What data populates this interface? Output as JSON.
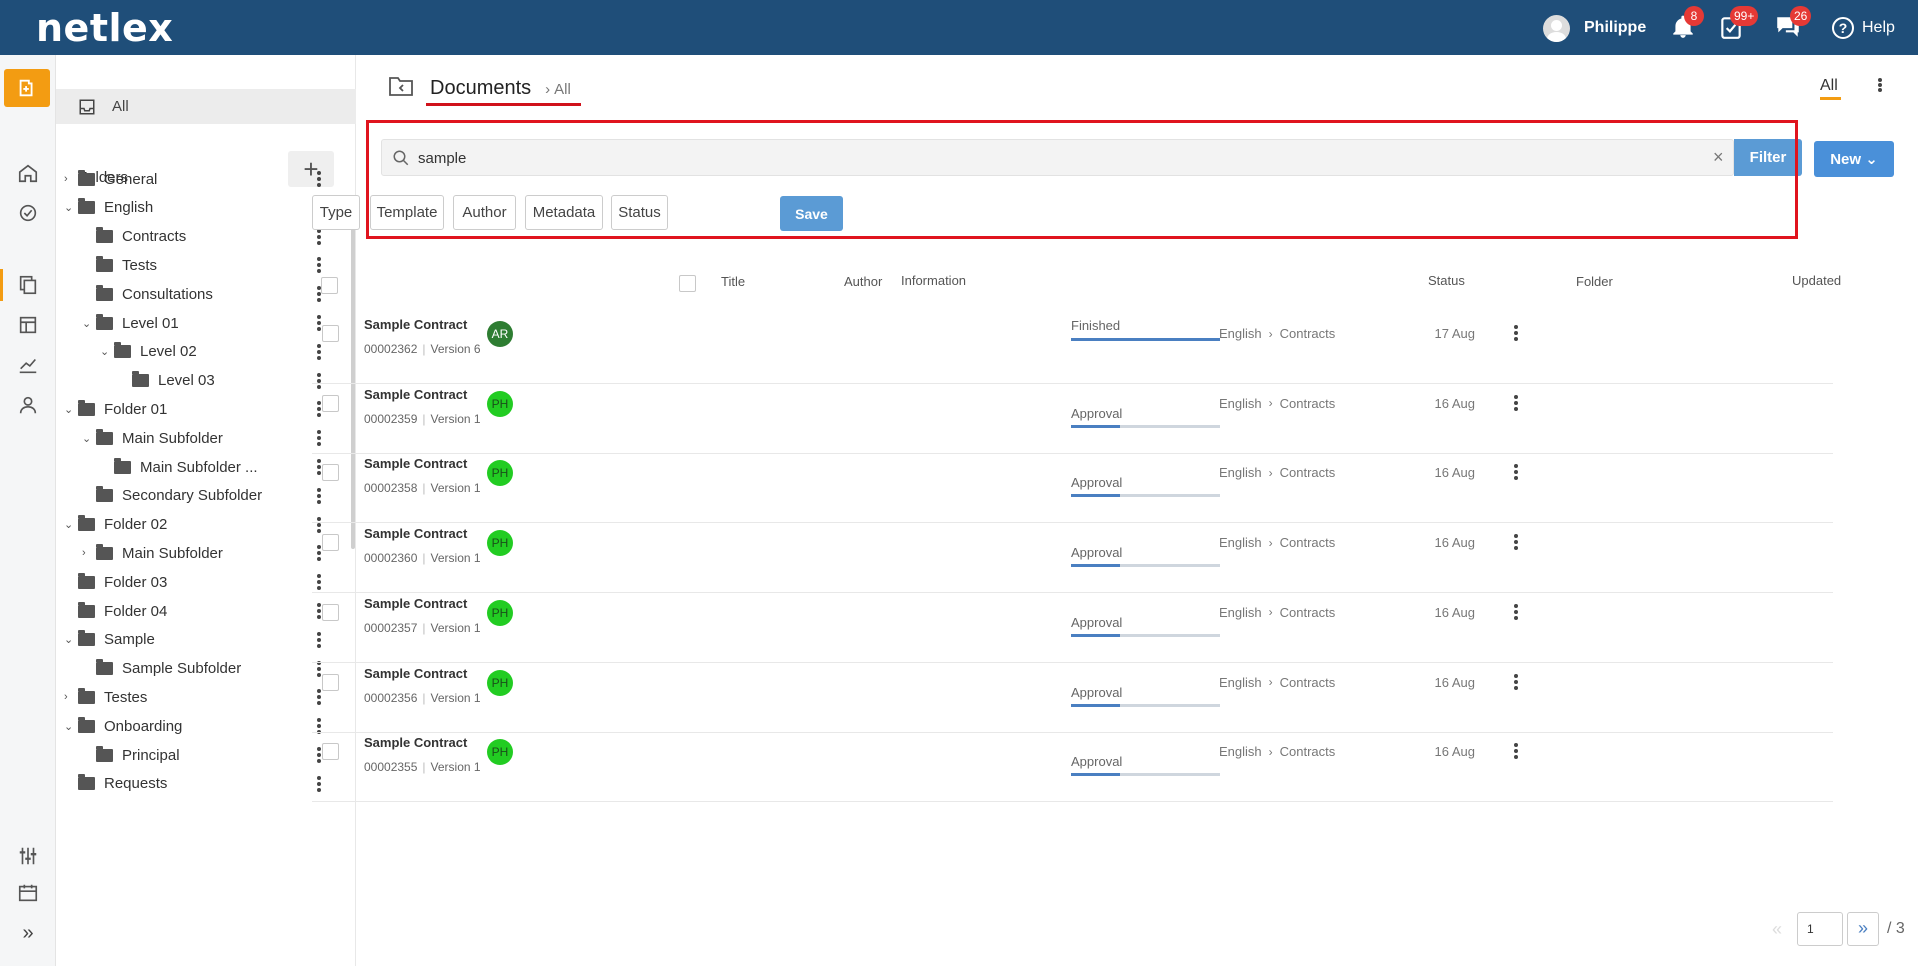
{
  "app": {
    "logo": "netlex"
  },
  "topbar": {
    "user_name": "Philippe",
    "notifications_badge": "8",
    "tasks_badge": "99+",
    "messages_badge": "26",
    "help_label": "Help"
  },
  "rail": {
    "icons": [
      "new-document-icon",
      "home-icon",
      "dashboard-icon",
      "documents-icon",
      "board-icon",
      "analytics-icon",
      "user-icon",
      "settings-sliders-icon",
      "calendar-icon",
      "expand-icon"
    ]
  },
  "sidebar": {
    "all_label": "All",
    "folders_label": "Folders",
    "add_label": "+",
    "tree": [
      {
        "label": "General",
        "indent": 0,
        "chevron": "›"
      },
      {
        "label": "English",
        "indent": 0,
        "chevron": "⌄"
      },
      {
        "label": "Contracts",
        "indent": 1,
        "chevron": ""
      },
      {
        "label": "Tests",
        "indent": 1,
        "chevron": ""
      },
      {
        "label": "Consultations",
        "indent": 1,
        "chevron": ""
      },
      {
        "label": "Level 01",
        "indent": 1,
        "chevron": "⌄"
      },
      {
        "label": "Level 02",
        "indent": 2,
        "chevron": "⌄"
      },
      {
        "label": "Level 03",
        "indent": 3,
        "chevron": ""
      },
      {
        "label": "Folder 01",
        "indent": 0,
        "chevron": "⌄"
      },
      {
        "label": "Main Subfolder",
        "indent": 1,
        "chevron": "⌄"
      },
      {
        "label": "Main Subfolder ...",
        "indent": 2,
        "chevron": ""
      },
      {
        "label": "Secondary Subfolder",
        "indent": 1,
        "chevron": ""
      },
      {
        "label": "Folder 02",
        "indent": 0,
        "chevron": "⌄"
      },
      {
        "label": "Main Subfolder",
        "indent": 1,
        "chevron": "›"
      },
      {
        "label": "Folder 03",
        "indent": 0,
        "chevron": ""
      },
      {
        "label": "Folder 04",
        "indent": 0,
        "chevron": ""
      },
      {
        "label": "Sample",
        "indent": 0,
        "chevron": "⌄"
      },
      {
        "label": "Sample Subfolder",
        "indent": 1,
        "chevron": ""
      },
      {
        "label": "Testes",
        "indent": 0,
        "chevron": "›"
      },
      {
        "label": "Onboarding",
        "indent": 0,
        "chevron": "⌄"
      },
      {
        "label": "Principal",
        "indent": 1,
        "chevron": ""
      },
      {
        "label": "Requests",
        "indent": 0,
        "chevron": ""
      }
    ]
  },
  "header": {
    "title": "Documents",
    "breadcrumb_sub": "All",
    "view_label": "All"
  },
  "search": {
    "value": "sample",
    "clear_label": "×",
    "filter_label": "Filter",
    "new_label": "New ⌄"
  },
  "chips": [
    {
      "label": "Type",
      "name": "type"
    },
    {
      "label": "Template",
      "name": "template"
    },
    {
      "label": "Author",
      "name": "author"
    },
    {
      "label": "Metadata",
      "name": "metadata"
    },
    {
      "label": "Status",
      "name": "status"
    }
  ],
  "chips_save_label": "Save",
  "table": {
    "columns": {
      "title": "Title",
      "author": "Author",
      "information": "Information",
      "status": "Status",
      "folder": "Folder",
      "updated": "Updated"
    },
    "rows": [
      {
        "title": "Sample Contract",
        "number": "00002362",
        "version": "Version 6",
        "author": "AR",
        "author_color": "#2e7d32",
        "author_text": "#ffffff",
        "status": "Finished",
        "progress": 1.0,
        "folder": [
          "English",
          "Contracts"
        ],
        "updated": "17 Aug"
      },
      {
        "title": "Sample Contract",
        "number": "00002359",
        "version": "Version 1",
        "author": "PH",
        "author_color": "#22cc22",
        "author_text": "#1a4d1a",
        "status": "Approval",
        "progress": 0.33,
        "folder": [
          "English",
          "Contracts"
        ],
        "updated": "16 Aug"
      },
      {
        "title": "Sample Contract",
        "number": "00002358",
        "version": "Version 1",
        "author": "PH",
        "author_color": "#22cc22",
        "author_text": "#1a4d1a",
        "status": "Approval",
        "progress": 0.33,
        "folder": [
          "English",
          "Contracts"
        ],
        "updated": "16 Aug"
      },
      {
        "title": "Sample Contract",
        "number": "00002360",
        "version": "Version 1",
        "author": "PH",
        "author_color": "#22cc22",
        "author_text": "#1a4d1a",
        "status": "Approval",
        "progress": 0.33,
        "folder": [
          "English",
          "Contracts"
        ],
        "updated": "16 Aug"
      },
      {
        "title": "Sample Contract",
        "number": "00002357",
        "version": "Version 1",
        "author": "PH",
        "author_color": "#22cc22",
        "author_text": "#1a4d1a",
        "status": "Approval",
        "progress": 0.33,
        "folder": [
          "English",
          "Contracts"
        ],
        "updated": "16 Aug"
      },
      {
        "title": "Sample Contract",
        "number": "00002356",
        "version": "Version 1",
        "author": "PH",
        "author_color": "#22cc22",
        "author_text": "#1a4d1a",
        "status": "Approval",
        "progress": 0.33,
        "folder": [
          "English",
          "Contracts"
        ],
        "updated": "16 Aug"
      },
      {
        "title": "Sample Contract",
        "number": "00002355",
        "version": "Version 1",
        "author": "PH",
        "author_color": "#22cc22",
        "author_text": "#1a4d1a",
        "status": "Approval",
        "progress": 0.33,
        "folder": [
          "English",
          "Contracts"
        ],
        "updated": "16 Aug"
      }
    ]
  },
  "pagination": {
    "current": "1",
    "total": "/ 3",
    "prev_label": "«",
    "next_label": "»"
  },
  "colors": {
    "topbar": "#1f4e79",
    "accent": "#f39c12",
    "primary": "#5b9bd5",
    "highlight": "#e0141e"
  }
}
